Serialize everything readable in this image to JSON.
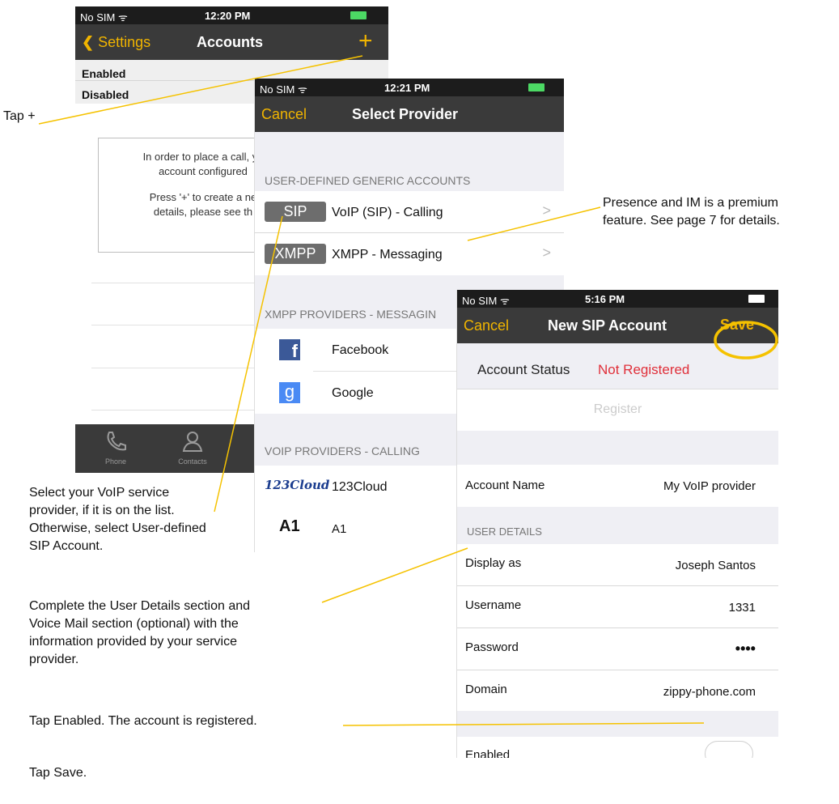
{
  "screen1": {
    "status": {
      "carrier": "No SIM ᯤ",
      "time": "12:20 PM"
    },
    "nav": {
      "back": "Settings",
      "title": "Accounts",
      "add": "+"
    },
    "rows": [
      "Enabled",
      "Disabled"
    ],
    "message": {
      "line1": "In order to place a call, yo",
      "line2": "account configured",
      "line3": "Press '+' to create a ne",
      "line4": "details, please see th"
    },
    "tabs": [
      {
        "label": "Phone"
      },
      {
        "label": "Contacts"
      }
    ]
  },
  "screen2": {
    "status": {
      "carrier": "No SIM ᯤ",
      "time": "12:21 PM"
    },
    "nav": {
      "cancel": "Cancel",
      "title": "Select Provider"
    },
    "section_generic": "USER-DEFINED GENERIC ACCOUNTS",
    "generic": [
      {
        "badge": "SIP",
        "label": "VoIP (SIP) - Calling",
        "chev": ">"
      },
      {
        "badge": "XMPP",
        "label": "XMPP - Messaging",
        "chev": ">"
      }
    ],
    "section_xmpp": "XMPP PROVIDERS - MESSAGIN",
    "xmpp": [
      {
        "icon": "f",
        "label": "Facebook"
      },
      {
        "icon": "g",
        "label": "Google"
      }
    ],
    "section_voip": "VOIP PROVIDERS - CALLING",
    "voip": [
      {
        "icon": "123Cloud",
        "label": "123Cloud"
      },
      {
        "icon": "A1",
        "label": "A1"
      }
    ]
  },
  "screen3": {
    "status": {
      "carrier": "No SIM ᯤ",
      "time": "5:16 PM"
    },
    "nav": {
      "cancel": "Cancel",
      "title": "New SIP Account",
      "save": "Save"
    },
    "account_status": {
      "label": "Account Status",
      "value": "Not Registered"
    },
    "register": "Register",
    "account_name": {
      "label": "Account Name",
      "value": "My VoIP provider"
    },
    "section_user": "USER DETAILS",
    "display_as": {
      "label": "Display as",
      "value": "Joseph Santos"
    },
    "username": {
      "label": "Username",
      "value": "1331"
    },
    "password": {
      "label": "Password",
      "value": "••••"
    },
    "domain": {
      "label": "Domain",
      "value": "zippy-phone.com"
    },
    "enabled": {
      "label": "Enabled"
    }
  },
  "annotations": {
    "tap_plus": "Tap +",
    "premium": [
      "Presence and IM is a premium",
      "feature. See page 7 for details."
    ],
    "select_provider": [
      "Select your VoIP service",
      "provider, if it is on the list.",
      "Otherwise, select User-defined",
      "SIP Account."
    ],
    "complete": [
      "Complete the User Details section and",
      "Voice Mail section (optional) with the",
      "information provided by your service",
      "provider."
    ],
    "tap_enabled": "Tap Enabled. The account is registered.",
    "tap_save": "Tap Save."
  },
  "colors": {
    "accent": "#f0b400",
    "nav": "#3a3a3a",
    "status": "#1c1c1c",
    "error": "#e0303a",
    "leader": "#f5c200"
  }
}
